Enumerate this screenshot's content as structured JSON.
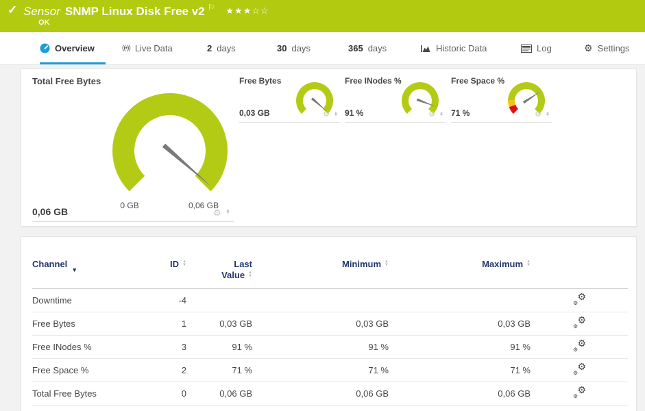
{
  "colors": {
    "banner_green": "#b2ca10",
    "gauge_green": "#b4cb16",
    "gauge_red": "#dc1212",
    "gauge_yellow": "#f5c40c",
    "accent_blue": "#1b9dd9",
    "table_header_navy": "#22366d",
    "needle_gray": "#7a7a7a"
  },
  "icons": {
    "check": "✓",
    "flag": "⚐",
    "gear": "⚙",
    "sort_up": "▲",
    "sort_down": "▼",
    "caret_down": "▼",
    "live": "((•))"
  },
  "header": {
    "type_label": "Sensor",
    "title": "SNMP Linux Disk Free v2",
    "stars_filled": "★★★",
    "stars_empty": "☆☆",
    "status": "OK"
  },
  "tabs": [
    {
      "label": "Overview",
      "active": true
    },
    {
      "label": "Live Data"
    },
    {
      "num": "2",
      "label": "days"
    },
    {
      "num": "30",
      "label": "days"
    },
    {
      "num": "365",
      "label": "days"
    },
    {
      "label": "Historic Data"
    },
    {
      "label": "Log"
    },
    {
      "label": "Settings"
    }
  ],
  "chart_data": {
    "type": "gauge-set",
    "main_gauge": {
      "title": "Total Free Bytes",
      "value": "0,06 GB",
      "min_label": "0 GB",
      "max_label": "0,06 GB",
      "pct": 0.985
    },
    "small_gauges": [
      {
        "title": "Free Bytes",
        "value": "0,03 GB",
        "pct": 0.985
      },
      {
        "title": "Free INodes %",
        "value": "91 %",
        "pct": 0.91
      },
      {
        "title": "Free Space %",
        "value": "71 %",
        "pct": 0.71,
        "segments": [
          [
            -135,
            -110,
            "red"
          ],
          [
            -110,
            -88,
            "yellow"
          ],
          [
            -88,
            135,
            "green"
          ]
        ]
      }
    ]
  },
  "table": {
    "headers": {
      "channel": "Channel",
      "id": "ID",
      "last_line1": "Last",
      "last_line2": "Value",
      "min": "Minimum",
      "max": "Maximum"
    },
    "rows": [
      {
        "channel": "Downtime",
        "id": "-4",
        "last": "",
        "min": "",
        "max": ""
      },
      {
        "channel": "Free Bytes",
        "id": "1",
        "last": "0,03 GB",
        "min": "0,03 GB",
        "max": "0,03 GB"
      },
      {
        "channel": "Free INodes %",
        "id": "3",
        "last": "91 %",
        "min": "91 %",
        "max": "91 %"
      },
      {
        "channel": "Free Space %",
        "id": "2",
        "last": "71 %",
        "min": "71 %",
        "max": "71 %"
      },
      {
        "channel": "Total Free Bytes",
        "id": "0",
        "last": "0,06 GB",
        "min": "0,06 GB",
        "max": "0,06 GB"
      }
    ]
  }
}
